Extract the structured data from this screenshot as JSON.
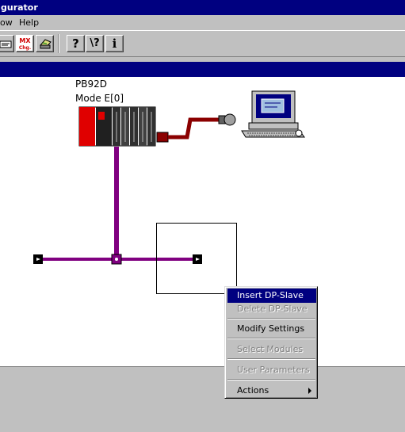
{
  "window": {
    "title": "gurator"
  },
  "menubar": {
    "items": [
      {
        "label": "ow"
      },
      {
        "label": "Help"
      }
    ]
  },
  "toolbar": {
    "buttons": [
      {
        "name": "doc-icon"
      },
      {
        "name": "mx-chg-icon",
        "top": "MX",
        "bottom": "Chg."
      },
      {
        "name": "print-icon"
      },
      {
        "name": "help-icon",
        "label": "?"
      },
      {
        "name": "context-help-icon",
        "label": "\\?"
      },
      {
        "name": "info-icon",
        "label": "i"
      }
    ]
  },
  "canvas": {
    "plc": {
      "line1": "PB92D",
      "line2": "Mode E[0]"
    }
  },
  "context_menu": {
    "items": [
      {
        "label": "Insert DP-Slave",
        "state": "highlighted"
      },
      {
        "label": "Delete DP-Slave",
        "state": "disabled"
      },
      {
        "label": "Modify Settings",
        "state": "enabled"
      },
      {
        "label": "Select Modules",
        "state": "disabled"
      },
      {
        "label": "User Parameters",
        "state": "disabled"
      },
      {
        "label": "Actions",
        "state": "enabled",
        "submenu": true
      }
    ]
  },
  "colors": {
    "titlebar": "#000080",
    "bus": "#800080",
    "cable": "#8b0000",
    "plc_red": "#e00000"
  }
}
